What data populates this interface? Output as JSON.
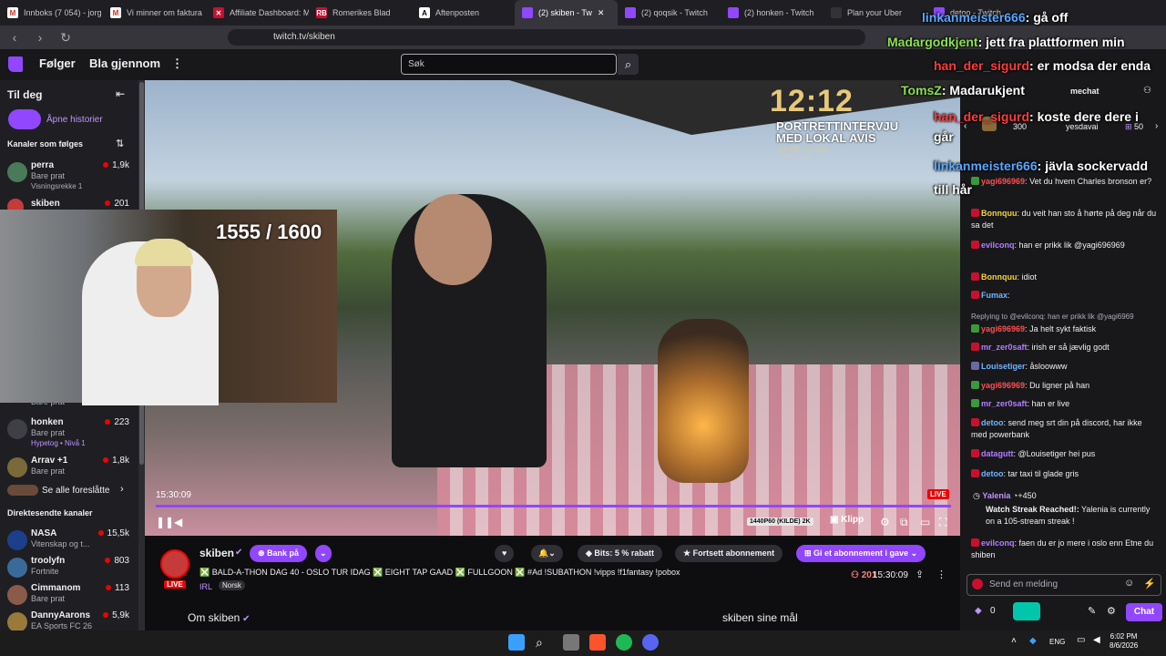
{
  "browser": {
    "tabs": [
      {
        "label": "Innboks (7 054) - jorg",
        "icon": "gmail-icon"
      },
      {
        "label": "Vi minner om faktura",
        "icon": "gmail-icon"
      },
      {
        "label": "Affiliate Dashboard: M",
        "icon": "affiliate-icon"
      },
      {
        "label": "Romerikes Blad",
        "icon": "rb-icon"
      },
      {
        "label": "Aftenposten",
        "icon": "aftenposten-icon"
      },
      {
        "label": "(2) skiben - Tw",
        "icon": "twitch-icon"
      },
      {
        "label": "(2) qoqsik - Twitch",
        "icon": "twitch-icon"
      },
      {
        "label": "(2) honken - Twitch",
        "icon": "twitch-icon"
      },
      {
        "label": "Plan your Uber",
        "icon": "uber-icon"
      },
      {
        "label": "detoo - Twitch",
        "icon": "twitch-icon"
      }
    ],
    "url": "twitch.tv/skiben"
  },
  "header": {
    "following": "Følger",
    "browse": "Bla gjennom",
    "search_placeholder": "Søk",
    "mechat": "mechat",
    "bits_count": "300",
    "yesdavai": "yesdavai",
    "sub_count": "50"
  },
  "sidebar": {
    "for_you": "Til deg",
    "open_stories": "Åpne historier",
    "followed_channels": "Kanaler som følges",
    "channels": [
      {
        "name": "perra",
        "game": "Bare prat",
        "extra": "Visningsrekke 1",
        "viewers": "1,9k"
      },
      {
        "name": "skiben",
        "game": "",
        "extra": "",
        "viewers": "201"
      },
      {
        "name": "",
        "game": "Bare prat",
        "extra": "",
        "viewers": ""
      },
      {
        "name": "honken",
        "game": "Bare prat",
        "extra": "Hypetog • Nivå 1",
        "viewers": "223"
      },
      {
        "name": "Arrav +1",
        "game": "Bare prat",
        "extra": "",
        "viewers": "1,8k"
      }
    ],
    "see_all_suggested": "Se alle foreslåtte",
    "recommended_title": "Direktesendte kanaler",
    "recommended": [
      {
        "name": "NASA",
        "game": "Vitenskap og t...",
        "viewers": "15,5k"
      },
      {
        "name": "troolyfn",
        "game": "Fortnite",
        "viewers": "803"
      },
      {
        "name": "Cimmanom",
        "game": "Bare prat",
        "viewers": "113"
      },
      {
        "name": "DannyAarons",
        "game": "EA Sports FC 26",
        "viewers": "5,9k"
      }
    ]
  },
  "video": {
    "goal": "1555 / 1600",
    "overlay_clock": "12:12",
    "overlay_title_1": "PORTRETTINTERVJU",
    "overlay_title_2": "MED LOKAL AVIS",
    "overlay_progress": "52 435 / 60 000",
    "overlay_left": "7 565 kr igjen",
    "timestamp": "15:30:09",
    "live": "LIVE",
    "quality": "1440P60 (KILDE) 2K",
    "clip": "Klipp"
  },
  "stream": {
    "name": "skiben",
    "live_badge": "LIVE",
    "bank_label": "Bank på",
    "bits_label": "Bits: 5 % rabatt",
    "continue_sub": "Fortsett abonnement",
    "gift_sub": "Gi et abonnement i gave",
    "title": "❎ BALD-A-THON DAG 40 - OSLO TUR IDAG ❎ EIGHT TAP GAAD ❎ FULLGOON ❎ #Ad !SUBATHON !vipps !f1fantasy !pobox",
    "category": "IRL",
    "language": "Norsk",
    "viewers": "201",
    "uptime": "15:30:09",
    "about": "Om skiben",
    "goals": "skiben sine mål"
  },
  "overlay_chat": [
    {
      "user": "linkanmeister666",
      "msg": "gå off",
      "color": "#58a6ff"
    },
    {
      "user": "Madargodkjent",
      "msg": "jett fra plattformen min",
      "color": "#8be04e"
    },
    {
      "user": "han_der_sigurd",
      "msg": "er modsa der enda",
      "color": "#ff3b3b"
    },
    {
      "user": "TomsZ",
      "msg": "Madarukjent",
      "color": "#8be04e"
    },
    {
      "user": "han_der_sigurd",
      "msg": "koste dere dere i går",
      "color": "#ff3b3b"
    },
    {
      "user": "linkanmeister666",
      "msg": "jävla sockervadd till hår",
      "color": "#58a6ff"
    }
  ],
  "chat": [
    {
      "user": "yagi696969",
      "msg": "Vet du hvem Charles bronson er?",
      "color": "#ff4f4f"
    },
    {
      "user": "Bonnquu",
      "msg": "du veit han sto å hørte på deg når du sa det",
      "color": "#f3d13a"
    },
    {
      "user": "evilconq",
      "msg": "han er prikk lik @yagi696969",
      "color": "#b57cff"
    },
    {
      "user": "Bonnquu",
      "msg": "idiot",
      "color": "#f3d13a"
    },
    {
      "user": "Fumax",
      "msg": "",
      "color": "#6fb4ff"
    },
    {
      "user": "",
      "msg": "Replying to @evilconq: han er prikk lik @yagi6969",
      "color": "#adadb8"
    },
    {
      "user": "yagi696969",
      "msg": "Ja helt sykt faktisk",
      "color": "#ff4f4f"
    },
    {
      "user": "mr_zer0saft",
      "msg": "irish er så jævlig godt",
      "color": "#b57cff"
    },
    {
      "user": "Louisetiger",
      "msg": "åsloowww",
      "color": "#6fb4ff"
    },
    {
      "user": "yagi696969",
      "msg": "Du ligner på han",
      "color": "#ff4f4f"
    },
    {
      "user": "mr_zer0saft",
      "msg": "han er live",
      "color": "#b57cff"
    },
    {
      "user": "detoo",
      "msg": "send meg srt din på discord, har ikke med powerbank",
      "color": "#6fb4ff"
    },
    {
      "user": "datagutt",
      "msg": "@Louisetiger hei pus",
      "color": "#b57cff"
    },
    {
      "user": "detoo",
      "msg": "tar taxi til glade gris",
      "color": "#6fb4ff"
    }
  ],
  "streak": {
    "user": "Yalenia",
    "points": "+450",
    "title": "Watch Streak Reached!:",
    "text": "Yalenia is currently on a 105-stream streak !"
  },
  "last_chat": {
    "user": "evilconq",
    "msg": "faen du er jo mere i oslo enn Etne du shiben",
    "color": "#b57cff"
  },
  "chat_input": {
    "placeholder": "Send en melding",
    "points": "0",
    "send": "Chat"
  },
  "taskbar": {
    "lang": "ENG",
    "time": "6:02 PM",
    "date": "8/6/2026"
  }
}
